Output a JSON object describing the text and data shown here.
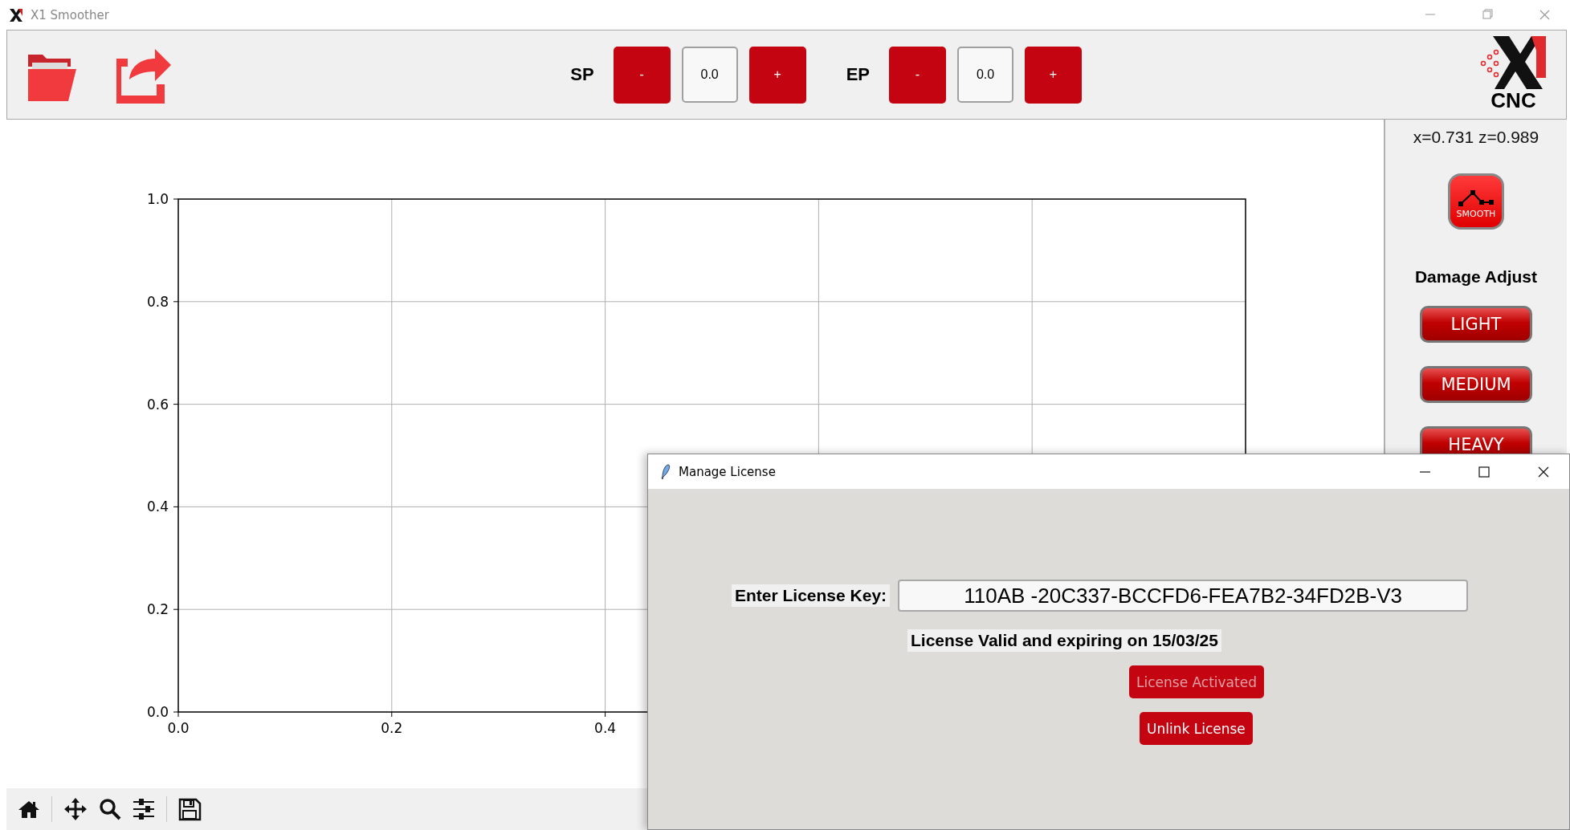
{
  "window": {
    "title": "X1 Smoother"
  },
  "toolbar": {
    "steppers": [
      {
        "label": "SP",
        "minus": "-",
        "value": "0.0",
        "plus": "+"
      },
      {
        "label": "EP",
        "minus": "-",
        "value": "0.0",
        "plus": "+"
      }
    ],
    "logo_text": "CNC"
  },
  "chart": {
    "chart_data": {
      "type": "line",
      "grid": true,
      "xlim": [
        0,
        1
      ],
      "ylim": [
        0,
        1
      ],
      "xticks": [
        {
          "value": 0,
          "label": "0.0"
        },
        {
          "value": 0.2,
          "label": "0.2"
        },
        {
          "value": 0.4,
          "label": "0.4"
        }
      ],
      "yticks": [
        {
          "value": 0,
          "label": "0.0"
        },
        {
          "value": 0.2,
          "label": "0.2"
        },
        {
          "value": 0.4,
          "label": "0.4"
        },
        {
          "value": 0.6,
          "label": "0.6"
        },
        {
          "value": 0.8,
          "label": "0.8"
        },
        {
          "value": 1,
          "label": "1.0"
        }
      ]
    }
  },
  "side_panel": {
    "coords": "x=0.731 z=0.989",
    "smooth_button": "SMOOTH",
    "heading": "Damage Adjust",
    "damage_buttons": [
      "LIGHT",
      "MEDIUM",
      "HEAVY"
    ]
  },
  "dialog": {
    "title": "Manage License",
    "key_label": "Enter License Key:",
    "key_value": "110AB -20C337-BCCFD6-FEA7B2-34FD2B-V3",
    "status": "License Valid and expiring on 15/03/25",
    "buttons": [
      {
        "label": "License Activated",
        "disabled": true
      },
      {
        "label": "Unlink License",
        "disabled": false
      }
    ]
  }
}
